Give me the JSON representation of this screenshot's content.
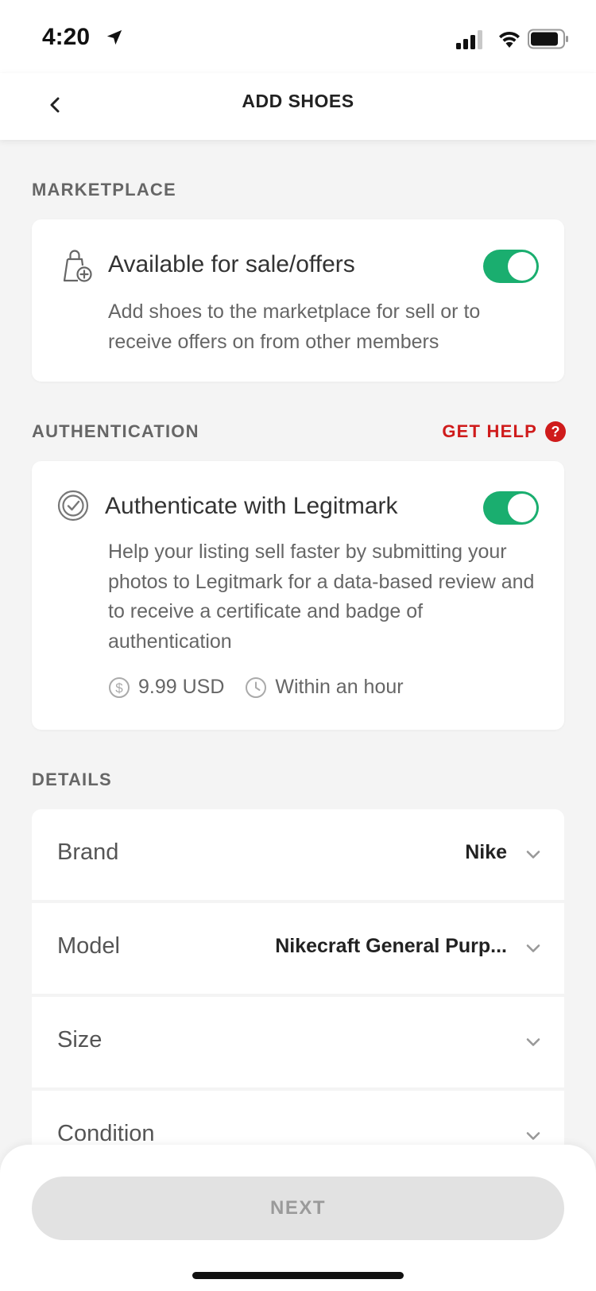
{
  "status_bar": {
    "time": "4:20"
  },
  "nav": {
    "title": "ADD SHOES"
  },
  "marketplace": {
    "section_label": "MARKETPLACE",
    "title": "Available for sale/offers",
    "description": "Add shoes to the marketplace for sell or to receive offers on from other members",
    "toggle_on": true
  },
  "authentication": {
    "section_label": "AUTHENTICATION",
    "help_label": "GET HELP",
    "help_icon_glyph": "?",
    "title": "Authenticate with Legitmark",
    "description": "Help your listing sell faster by submitting your photos to Legitmark for a data-based review and to receive a certificate and badge of authentication",
    "price": "9.99 USD",
    "turnaround": "Within an hour",
    "toggle_on": true
  },
  "details": {
    "section_label": "DETAILS",
    "rows": [
      {
        "label": "Brand",
        "value": "Nike"
      },
      {
        "label": "Model",
        "value": "Nikecraft General Purp..."
      },
      {
        "label": "Size",
        "value": ""
      },
      {
        "label": "Condition",
        "value": ""
      }
    ]
  },
  "footer": {
    "next_label": "NEXT"
  },
  "colors": {
    "accent_green": "#1aae6f",
    "help_red": "#cf1b1b",
    "disabled_button": "#e2e2e2"
  }
}
